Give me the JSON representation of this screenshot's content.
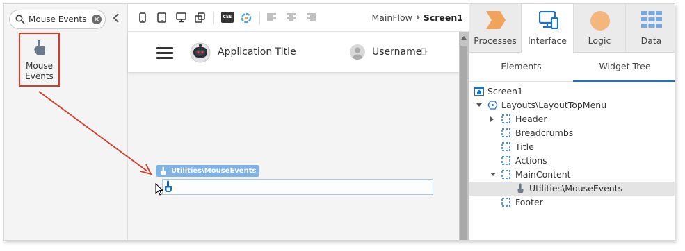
{
  "toolbox": {
    "search_value": "Mouse Events",
    "clear_symbol": "×",
    "item_label_line1": "Mouse",
    "item_label_line2": "Events"
  },
  "canvas_toolbar": {
    "breadcrumb_flow": "MainFlow",
    "breadcrumb_screen": "Screen1",
    "css_label": "CSS"
  },
  "app_header": {
    "title": "Application Title",
    "username": "Username"
  },
  "widget": {
    "badge_label": "Utilities\\MouseEvents"
  },
  "right_panel": {
    "tabs": [
      {
        "label": "Processes"
      },
      {
        "label": "Interface"
      },
      {
        "label": "Logic"
      },
      {
        "label": "Data"
      }
    ],
    "active_tab": "Interface",
    "subtabs": [
      {
        "label": "Elements"
      },
      {
        "label": "Widget Tree"
      }
    ],
    "tree": [
      {
        "label": "Screen1"
      },
      {
        "label": "Layouts\\LayoutTopMenu"
      },
      {
        "label": "Header"
      },
      {
        "label": "Breadcrumbs"
      },
      {
        "label": "Title"
      },
      {
        "label": "Actions"
      },
      {
        "label": "MainContent"
      },
      {
        "label": "Utilities\\MouseEvents"
      },
      {
        "label": "Footer"
      }
    ]
  },
  "colors": {
    "accent_blue": "#1a73c9",
    "highlight_red": "#d93a25",
    "processes_orange": "#f0a35a",
    "logic_orange": "#f3b67d",
    "data_blue": "#7aa7dc",
    "widget_badge": "#7fb2e5"
  },
  "icons": {
    "search": "search-icon",
    "clear": "clear-icon",
    "collapse": "chevron-left-icon",
    "tool": "hand-pointer-icon",
    "logout": "logout-icon"
  }
}
